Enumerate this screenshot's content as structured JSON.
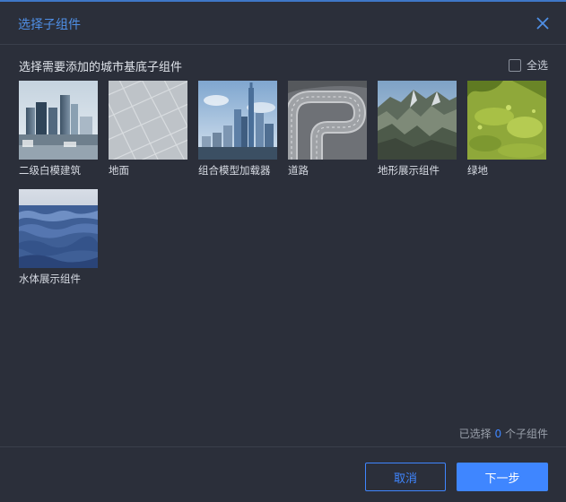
{
  "dialog": {
    "title": "选择子组件",
    "section_title": "选择需要添加的城市基底子组件",
    "select_all_label": "全选",
    "select_all_checked": false,
    "summary_prefix": "已选择",
    "selected_count": "0",
    "summary_suffix": "个子组件",
    "cancel_label": "取消",
    "next_label": "下一步"
  },
  "components": [
    {
      "label": "二级白模建筑",
      "icon": "white-model-buildings-thumbnail"
    },
    {
      "label": "地面",
      "icon": "ground-tiles-thumbnail"
    },
    {
      "label": "组合模型加载器",
      "icon": "city-model-loader-thumbnail"
    },
    {
      "label": "道路",
      "icon": "road-thumbnail"
    },
    {
      "label": "地形展示组件",
      "icon": "mountain-terrain-thumbnail"
    },
    {
      "label": "绿地",
      "icon": "green-land-thumbnail"
    },
    {
      "label": "水体展示组件",
      "icon": "water-surface-thumbnail"
    }
  ],
  "colors": {
    "accent": "#3f86ff",
    "title": "#4f8fe6",
    "background": "#2b2f3a"
  }
}
